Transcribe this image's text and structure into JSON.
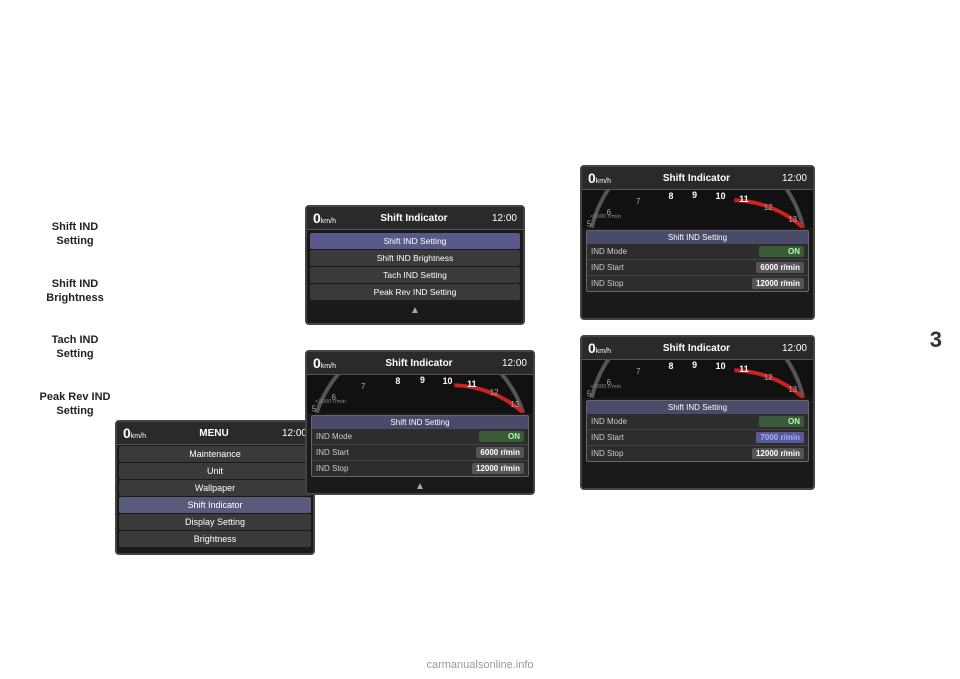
{
  "page": {
    "number": "3",
    "watermark": "carmanualsonline.info"
  },
  "sidebar": {
    "labels": [
      {
        "id": "shift-ind-setting",
        "line1": "Shift IND",
        "line2": "Setting"
      },
      {
        "id": "shift-ind-brightness",
        "line1": "Shift IND",
        "line2": "Brightness"
      },
      {
        "id": "tach-ind-setting",
        "line1": "Tach IND",
        "line2": "Setting"
      },
      {
        "id": "peak-rev-ind-setting",
        "line1": "Peak Rev IND",
        "line2": "Setting"
      }
    ]
  },
  "menu_screen": {
    "speed": "0",
    "speed_unit": "km/h",
    "title": "MENU",
    "time": "12:00",
    "items": [
      {
        "label": "Maintenance",
        "highlighted": false
      },
      {
        "label": "Unit",
        "highlighted": false
      },
      {
        "label": "Wallpaper",
        "highlighted": false
      },
      {
        "label": "Shift Indicator",
        "highlighted": true
      },
      {
        "label": "Display Setting",
        "highlighted": false
      },
      {
        "label": "Brightness",
        "highlighted": false
      }
    ]
  },
  "shift_indicator_screen": {
    "speed": "0",
    "speed_unit": "km/h",
    "title": "Shift Indicator",
    "time": "12:00",
    "items": [
      {
        "label": "Shift IND Setting",
        "highlighted": true
      },
      {
        "label": "Shift IND Brightness",
        "highlighted": false
      },
      {
        "label": "Tach IND Setting",
        "highlighted": false
      },
      {
        "label": "Peak Rev IND Setting",
        "highlighted": false
      }
    ]
  },
  "bottom_left_screen": {
    "speed": "0",
    "speed_unit": "km/h",
    "rpm_unit": "×1000 r/min",
    "title": "Shift Indicator",
    "time": "12:00",
    "gauge_numbers": [
      "5",
      "6",
      "7",
      "8",
      "9",
      "10",
      "11",
      "12",
      "13"
    ],
    "panel_title": "Shift IND Setting",
    "rows": [
      {
        "label": "IND Mode",
        "value": "ON",
        "type": "on"
      },
      {
        "label": "IND Start",
        "value": "6000 r/min",
        "type": "normal"
      },
      {
        "label": "IND Stop",
        "value": "12000 r/min",
        "type": "normal"
      }
    ]
  },
  "top_right_screen": {
    "speed": "0",
    "speed_unit": "km/h",
    "rpm_unit": "×1000 r/min",
    "title": "Shift Indicator",
    "time": "12:00",
    "gauge_numbers": [
      "5",
      "6",
      "7",
      "8",
      "9",
      "10",
      "11",
      "12",
      "13"
    ],
    "panel_title": "Shift IND Setting",
    "rows": [
      {
        "label": "IND Mode",
        "value": "ON",
        "type": "on"
      },
      {
        "label": "IND Start",
        "value": "6000 r/min",
        "type": "normal"
      },
      {
        "label": "IND Stop",
        "value": "12000 r/min",
        "type": "normal"
      }
    ]
  },
  "bottom_right_screen": {
    "speed": "0",
    "speed_unit": "km/h",
    "rpm_unit": "×1000 r/min",
    "title": "Shift Indicator",
    "time": "12:00",
    "gauge_numbers": [
      "5",
      "6",
      "7",
      "8",
      "9",
      "10",
      "11",
      "12",
      "13"
    ],
    "panel_title": "Shift IND Setting",
    "rows": [
      {
        "label": "IND Mode",
        "value": "ON",
        "type": "on"
      },
      {
        "label": "IND Start",
        "value": "7000 r/min",
        "type": "selected"
      },
      {
        "label": "IND Stop",
        "value": "12000 r/min",
        "type": "normal"
      }
    ]
  },
  "colors": {
    "bg": "#ffffff",
    "screen_bg": "#1a1a1a",
    "header_bg": "#2a2a2a",
    "menu_item_normal": "#3a3a3a",
    "menu_item_highlight": "#5a5a7a",
    "text_white": "#ffffff",
    "text_gray": "#cccccc",
    "ind_on": "#3a5a3a",
    "ind_selected": "#5a5a9a",
    "panel_title_bg": "#4a4a6a"
  }
}
